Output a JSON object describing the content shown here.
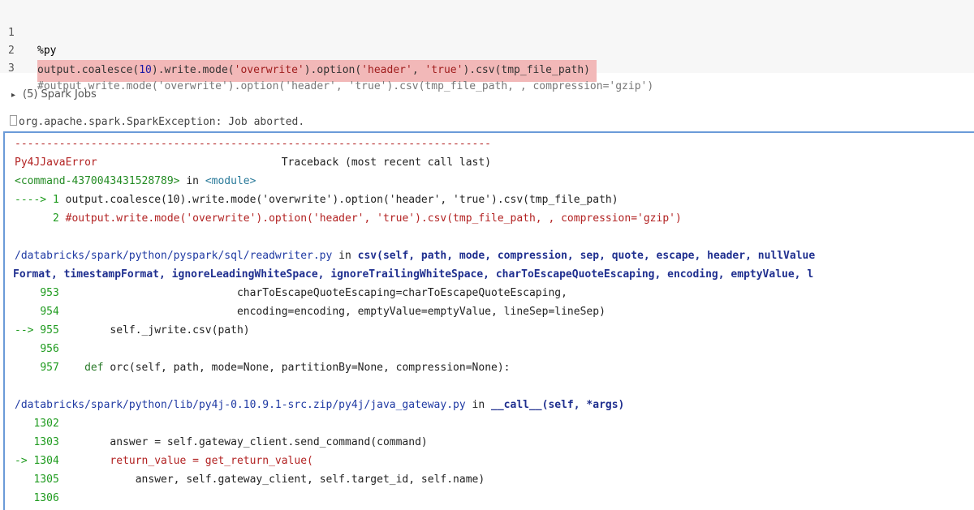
{
  "code": {
    "lines": [
      {
        "num": "1",
        "text": "%py"
      },
      {
        "num": "2",
        "pre": "output.coalesce(",
        "num_arg": "10",
        "mid": ").write.mode(",
        "s1": "'overwrite'",
        "mid2": ").option(",
        "s2": "'header'",
        "comma": ", ",
        "s3": "'true'",
        "tail": ").csv(tmp_file_path)"
      },
      {
        "num": "3",
        "text": "#output.write.mode('overwrite').option('header', 'true').csv(tmp_file_path, , compression='gzip')"
      }
    ]
  },
  "spark_jobs": {
    "label": "(5) Spark Jobs"
  },
  "exception": {
    "text": "org.apache.spark.SparkException: Job aborted."
  },
  "traceback": {
    "separator": "---------------------------------------------------------------------------",
    "error_name": "Py4JJavaError",
    "header": "Traceback (most recent call last)",
    "cmd_ref": "<command-4370043431528789>",
    "cmd_in": " in ",
    "cmd_module": "<module>",
    "line1_prefix": "----> 1 ",
    "line1_code": "output.coalesce(10).write.mode('overwrite').option('header', 'true').csv(tmp_file_path)",
    "line2_prefix": "      2 ",
    "line2_code": "#output.write.mode('overwrite').option('header', 'true').csv(tmp_file_path, , compression='gzip')",
    "frame1_path": "/databricks/spark/python/pyspark/sql/readwriter.py",
    "frame1_in": " in ",
    "frame1_sig": "csv(self, path, mode, compression, sep, quote, escape, header, nullValue",
    "frame1_sig2": "Format, timestampFormat, ignoreLeadingWhiteSpace, ignoreTrailingWhiteSpace, charToEscapeQuoteEscaping, encoding, emptyValue, l",
    "f1_l953_num": "953",
    "f1_l953": "                            charToEscapeQuoteEscaping=charToEscapeQuoteEscaping,",
    "f1_l954_num": "954",
    "f1_l954": "                            encoding=encoding, emptyValue=emptyValue, lineSep=lineSep)",
    "f1_l955_arrow": "--> 955",
    "f1_l955": "        self._jwrite.csv(path)",
    "f1_l956_num": "956",
    "f1_l957_num": "957",
    "f1_l957_kw": "    def",
    "f1_l957": " orc(self, path, mode=None, partitionBy=None, compression=None):",
    "frame2_path": "/databricks/spark/python/lib/py4j-0.10.9.1-src.zip/py4j/java_gateway.py",
    "frame2_in": " in ",
    "frame2_sig": "__call__(self, *args)",
    "f2_l1302_num": "1302",
    "f2_l1303_num": "1303",
    "f2_l1303": "        answer = self.gateway_client.send_command(command)",
    "f2_l1304_arrow": "-> 1304",
    "f2_l1304": "        return_value = get_return_value(",
    "f2_l1305_num": "1305",
    "f2_l1305": "            answer, self.gateway_client, self.target_id, self.name)",
    "f2_l1306_num": "1306"
  },
  "colors": {
    "highlight": "#f2b8b8",
    "panel_border": "#6b9bd8",
    "error": "#b22222",
    "path": "#1f3aa3"
  }
}
